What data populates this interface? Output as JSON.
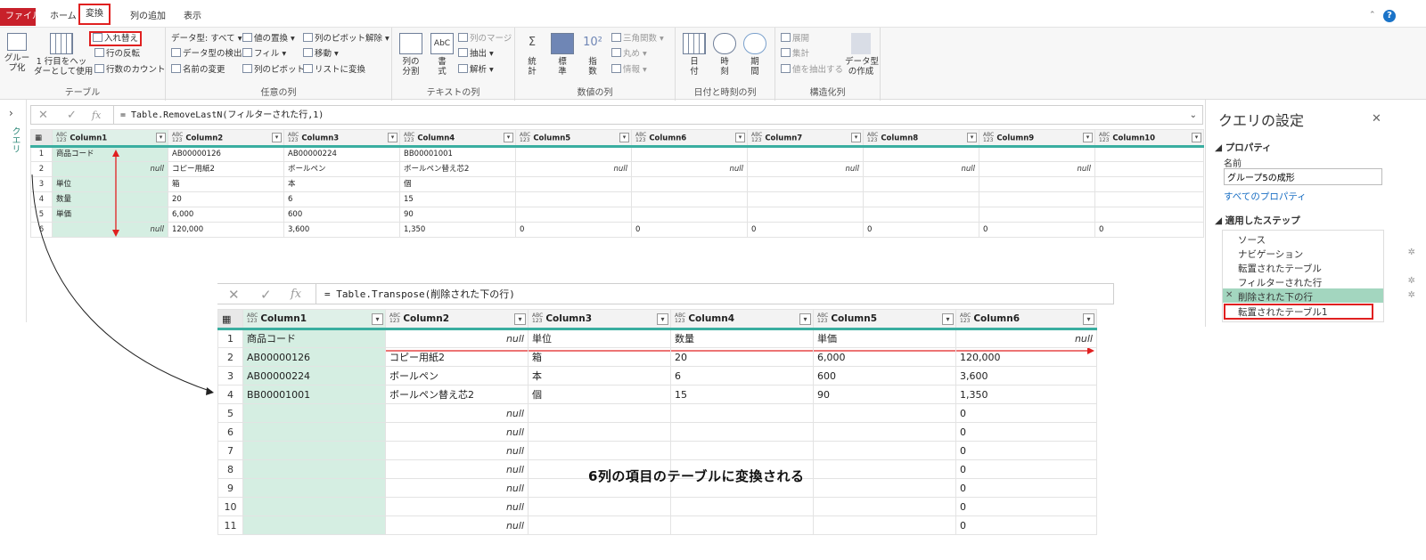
{
  "tabs": [
    "ファイル",
    "ホーム",
    "変換",
    "列の追加",
    "表示"
  ],
  "ribbon": {
    "table_group": {
      "label": "テーブル",
      "group_by": "グルー\nプ化",
      "first_row": "1 行目をヘッ\nダーとして使用",
      "transpose": "入れ替え",
      "reverse_rows": "行の反転",
      "count_rows": "行数のカウント"
    },
    "any_column_group": {
      "label": "任意の列",
      "data_type": "データ型: すべて",
      "detect_type": "データ型の検出",
      "rename": "名前の変更",
      "replace_values": "値の置換",
      "fill": "フィル",
      "pivot": "列のピボット",
      "unpivot": "列のピボット解除",
      "move": "移動",
      "to_list": "リストに変換"
    },
    "text_group": {
      "label": "テキストの列",
      "split": "列の\n分割",
      "format": "書\n式",
      "merge": "列のマージ",
      "extract": "抽出",
      "parse": "解析"
    },
    "number_group": {
      "label": "数値の列",
      "stats": "統\n計",
      "standard": "標\n準",
      "sci": "指\n数",
      "trig": "三角関数",
      "round": "丸め",
      "info": "情報"
    },
    "datetime_group": {
      "label": "日付と時刻の列",
      "date": "日\n付",
      "time": "時\n刻",
      "duration": "期\n間"
    },
    "structured_group": {
      "label": "構造化列",
      "expand": "展開",
      "aggregate": "集計",
      "extract_values": "値を抽出する",
      "create_data_type": "データ型\nの作成"
    }
  },
  "queries_label": "クエリ",
  "formula1": "= Table.RemoveLastN(フィルターされた行,1)",
  "formula2": "= Table.Transpose(削除された下の行)",
  "grid1": {
    "headers": [
      "Column1",
      "Column2",
      "Column3",
      "Column4",
      "Column5",
      "Column6",
      "Column7",
      "Column8",
      "Column9",
      "Column10"
    ],
    "rows": [
      [
        "1",
        "商品コード",
        "",
        "AB00000126",
        "AB00000224",
        "BB00001001",
        "",
        "",
        "",
        "",
        "",
        ""
      ],
      [
        "2",
        "",
        "null",
        "コピー用紙2",
        "ボールペン",
        "ボールペン替え芯2",
        "null",
        "null",
        "null",
        "null",
        "null",
        ""
      ],
      [
        "3",
        "単位",
        "",
        "箱",
        "本",
        "個",
        "",
        "",
        "",
        "",
        "",
        ""
      ],
      [
        "4",
        "数量",
        "",
        "20",
        "6",
        "15",
        "",
        "",
        "",
        "",
        "",
        ""
      ],
      [
        "5",
        "単価",
        "",
        "6,000",
        "600",
        "90",
        "",
        "",
        "",
        "",
        "",
        ""
      ],
      [
        "6",
        "",
        "null",
        "120,000",
        "3,600",
        "1,350",
        "0",
        "0",
        "0",
        "0",
        "0",
        "0"
      ]
    ]
  },
  "grid2": {
    "headers": [
      "Column1",
      "Column2",
      "Column3",
      "Column4",
      "Column5",
      "Column6"
    ],
    "rows": [
      [
        "1",
        "商品コード",
        "null",
        "単位",
        "数量",
        "単価",
        "null"
      ],
      [
        "2",
        "AB00000126",
        "コピー用紙2",
        "箱",
        "20",
        "6,000",
        "120,000"
      ],
      [
        "3",
        "AB00000224",
        "ボールペン",
        "本",
        "6",
        "600",
        "3,600"
      ],
      [
        "4",
        "BB00001001",
        "ボールペン替え芯2",
        "個",
        "15",
        "90",
        "1,350"
      ],
      [
        "5",
        "",
        "null",
        "",
        "",
        "",
        "0"
      ],
      [
        "6",
        "",
        "null",
        "",
        "",
        "",
        "0"
      ],
      [
        "7",
        "",
        "null",
        "",
        "",
        "",
        "0"
      ],
      [
        "8",
        "",
        "null",
        "",
        "",
        "",
        "0"
      ],
      [
        "9",
        "",
        "null",
        "",
        "",
        "",
        "0"
      ],
      [
        "10",
        "",
        "null",
        "",
        "",
        "",
        "0"
      ],
      [
        "11",
        "",
        "null",
        "",
        "",
        "",
        "0"
      ]
    ]
  },
  "settings": {
    "title": "クエリの設定",
    "properties": "プロパティ",
    "name_label": "名前",
    "name_value": "グループ5の成形",
    "all_props": "すべてのプロパティ",
    "steps_label": "適用したステップ",
    "steps": [
      "ソース",
      "ナビゲーション",
      "転置されたテーブル",
      "フィルターされた行",
      "削除された下の行",
      "転置されたテーブル1"
    ]
  },
  "caption": "6列の項目のテーブルに変換される"
}
